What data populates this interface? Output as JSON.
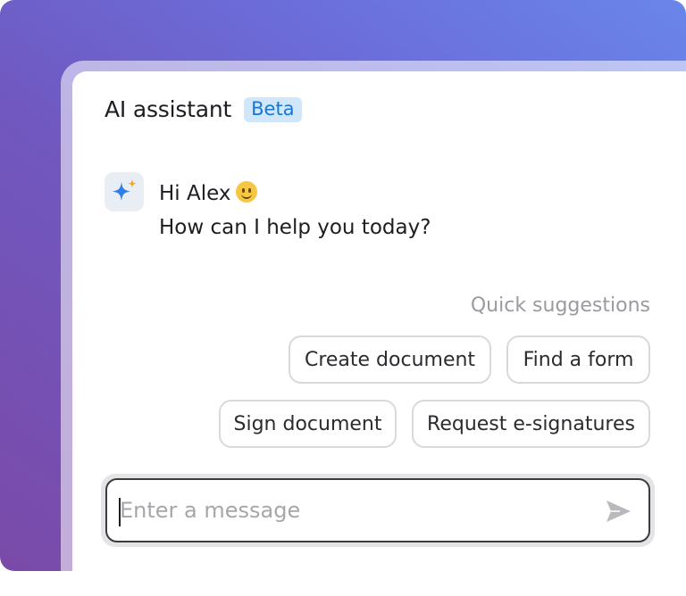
{
  "header": {
    "title": "AI assistant",
    "badge": "Beta"
  },
  "assistant": {
    "avatar_icon": "sparkle-icon",
    "greeting": "Hi Alex",
    "greeting_emoji_icon": "smiley-icon",
    "prompt": "How can I help you today?"
  },
  "suggestions": {
    "title": "Quick suggestions",
    "items": [
      {
        "label": "Create document"
      },
      {
        "label": "Find a form"
      },
      {
        "label": "Sign document"
      },
      {
        "label": "Request e-signatures"
      }
    ]
  },
  "composer": {
    "placeholder": "Enter a message",
    "value": "",
    "send_icon": "send-icon"
  },
  "colors": {
    "accent": "#1877d2",
    "badge_bg": "#cfe6fb",
    "sparkle_blue": "#2f7fe6",
    "sparkle_orange": "#f5a623"
  }
}
